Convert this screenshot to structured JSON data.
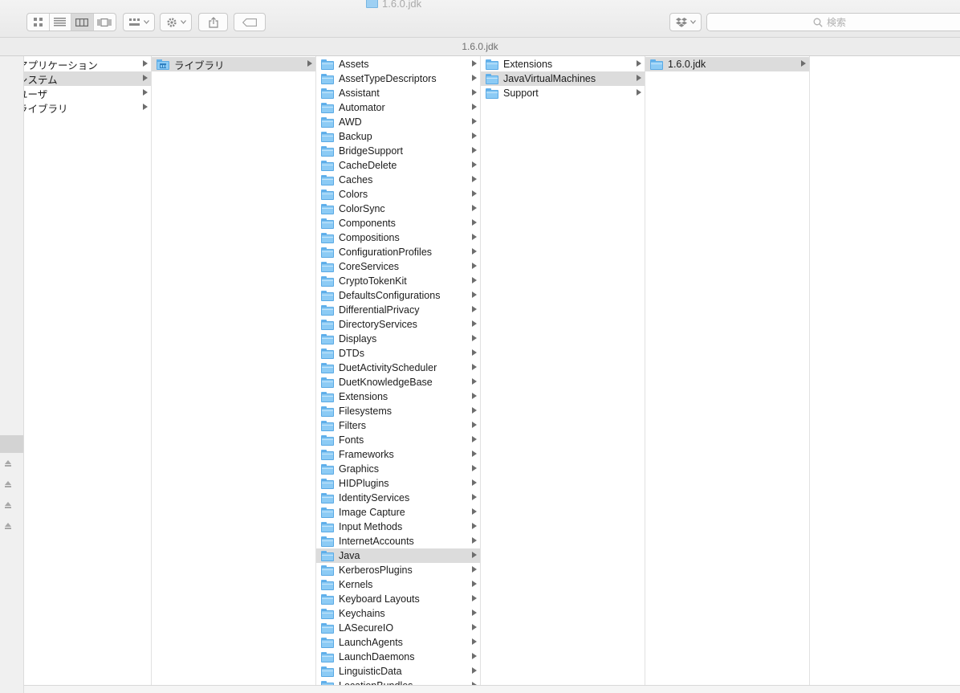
{
  "window": {
    "title": "1.6.0.jdk"
  },
  "toolbar": {
    "view_buttons": [
      "icon-view-icon",
      "list-view-icon",
      "column-view-icon",
      "coverflow-view-icon"
    ],
    "search_placeholder": "検索"
  },
  "pathbar": {
    "current": "1.6.0.jdk"
  },
  "columns": [
    {
      "items": [
        {
          "label": "アプリケーション",
          "selected": false
        },
        {
          "label": "システム",
          "selected": true
        },
        {
          "label": "ユーザ",
          "selected": false
        },
        {
          "label": "ライブラリ",
          "selected": false
        }
      ]
    },
    {
      "items": [
        {
          "label": "ライブラリ",
          "selected": true
        }
      ]
    },
    {
      "items": [
        {
          "label": "Assets"
        },
        {
          "label": "AssetTypeDescriptors"
        },
        {
          "label": "Assistant"
        },
        {
          "label": "Automator"
        },
        {
          "label": "AWD"
        },
        {
          "label": "Backup"
        },
        {
          "label": "BridgeSupport"
        },
        {
          "label": "CacheDelete"
        },
        {
          "label": "Caches"
        },
        {
          "label": "Colors"
        },
        {
          "label": "ColorSync"
        },
        {
          "label": "Components"
        },
        {
          "label": "Compositions"
        },
        {
          "label": "ConfigurationProfiles"
        },
        {
          "label": "CoreServices"
        },
        {
          "label": "CryptoTokenKit"
        },
        {
          "label": "DefaultsConfigurations"
        },
        {
          "label": "DifferentialPrivacy"
        },
        {
          "label": "DirectoryServices"
        },
        {
          "label": "Displays"
        },
        {
          "label": "DTDs"
        },
        {
          "label": "DuetActivityScheduler"
        },
        {
          "label": "DuetKnowledgeBase"
        },
        {
          "label": "Extensions"
        },
        {
          "label": "Filesystems"
        },
        {
          "label": "Filters"
        },
        {
          "label": "Fonts"
        },
        {
          "label": "Frameworks"
        },
        {
          "label": "Graphics"
        },
        {
          "label": "HIDPlugins"
        },
        {
          "label": "IdentityServices"
        },
        {
          "label": "Image Capture"
        },
        {
          "label": "Input Methods"
        },
        {
          "label": "InternetAccounts"
        },
        {
          "label": "Java",
          "selected": true
        },
        {
          "label": "KerberosPlugins"
        },
        {
          "label": "Kernels"
        },
        {
          "label": "Keyboard Layouts"
        },
        {
          "label": "Keychains"
        },
        {
          "label": "LASecureIO"
        },
        {
          "label": "LaunchAgents"
        },
        {
          "label": "LaunchDaemons"
        },
        {
          "label": "LinguisticData"
        },
        {
          "label": "LocationBundles"
        }
      ]
    },
    {
      "items": [
        {
          "label": "Extensions"
        },
        {
          "label": "JavaVirtualMachines",
          "selected": true
        },
        {
          "label": "Support"
        }
      ]
    },
    {
      "items": [
        {
          "label": "1.6.0.jdk",
          "selected": true
        }
      ]
    }
  ]
}
